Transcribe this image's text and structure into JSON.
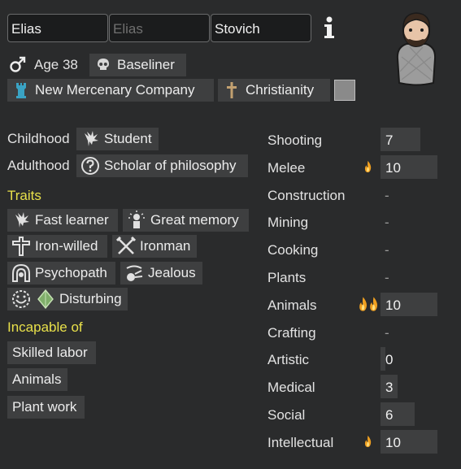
{
  "name": {
    "first": "Elias",
    "nick": "Elias",
    "last": "Stovich"
  },
  "info_icon": "info-icon",
  "bio": {
    "age": "Age 38",
    "xenotype": "Baseliner",
    "faction": "New Mercenary Company",
    "ideology": "Christianity"
  },
  "backstory": {
    "childhood_label": "Childhood",
    "childhood": "Student",
    "adulthood_label": "Adulthood",
    "adulthood": "Scholar of philosophy"
  },
  "traits": {
    "title": "Traits",
    "items": [
      "Fast learner",
      "Great memory",
      "Iron-willed",
      "Ironman",
      "Psychopath",
      "Jealous",
      "Disturbing"
    ]
  },
  "incapable": {
    "title": "Incapable of",
    "items": [
      "Skilled labor",
      "Animals",
      "Plant work"
    ]
  },
  "skills": [
    {
      "name": "Shooting",
      "value": "7",
      "level": 7,
      "passion": 0
    },
    {
      "name": "Melee",
      "value": "10",
      "level": 10,
      "passion": 1
    },
    {
      "name": "Construction",
      "value": "-",
      "level": null,
      "passion": 0
    },
    {
      "name": "Mining",
      "value": "-",
      "level": null,
      "passion": 0
    },
    {
      "name": "Cooking",
      "value": "-",
      "level": null,
      "passion": 0
    },
    {
      "name": "Plants",
      "value": "-",
      "level": null,
      "passion": 0
    },
    {
      "name": "Animals",
      "value": "10",
      "level": 10,
      "passion": 2
    },
    {
      "name": "Crafting",
      "value": "-",
      "level": null,
      "passion": 0
    },
    {
      "name": "Artistic",
      "value": "0",
      "level": 0,
      "passion": 0
    },
    {
      "name": "Medical",
      "value": "3",
      "level": 3,
      "passion": 0
    },
    {
      "name": "Social",
      "value": "6",
      "level": 6,
      "passion": 0
    },
    {
      "name": "Intellectual",
      "value": "10",
      "level": 10,
      "passion": 1
    }
  ],
  "colors": {
    "background": "#2a2b2c",
    "chip": "#3e3f40",
    "header_yellow": "#e8e04a",
    "faction_icon": "#3aa3c4",
    "passion_orange": "#f0a020"
  }
}
